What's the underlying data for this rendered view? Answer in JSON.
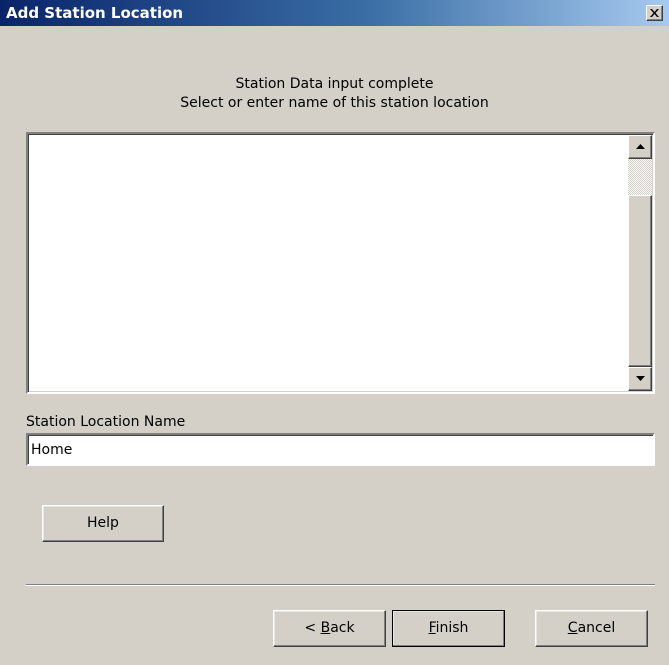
{
  "window": {
    "title": "Add Station Location"
  },
  "instructions": {
    "line1": "Station Data input complete",
    "line2": "Select or enter name of this station location"
  },
  "locations_list": {
    "items": []
  },
  "station_name": {
    "label": "Station Location Name",
    "value": "Home"
  },
  "buttons": {
    "help": "Help",
    "back_prefix": "< ",
    "back_accel": "B",
    "back_rest": "ack",
    "finish_accel": "F",
    "finish_rest": "inish",
    "cancel_accel": "C",
    "cancel_rest": "ancel"
  },
  "icons": {
    "close": "close-icon",
    "scroll_up": "arrow-up-icon",
    "scroll_down": "arrow-down-icon"
  }
}
